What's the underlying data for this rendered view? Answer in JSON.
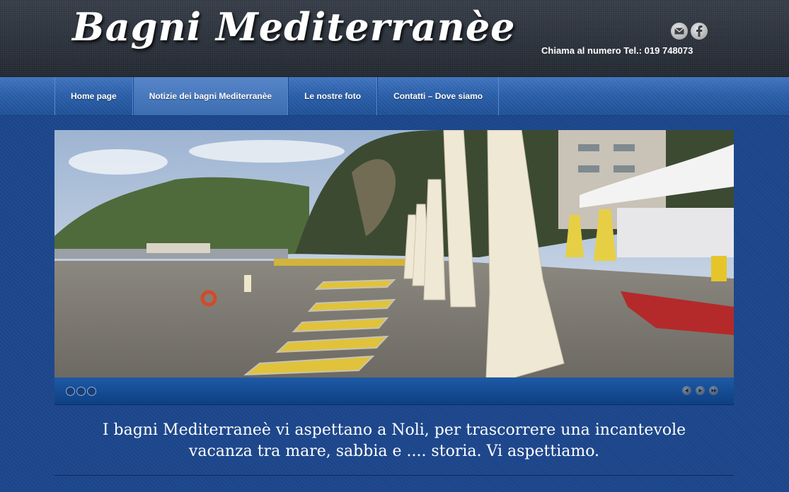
{
  "header": {
    "logo_text": "Bagni Mediterranèe",
    "phone_text": "Chiama al numero Tel.: 019 748073",
    "social": [
      {
        "icon": "mail-icon"
      },
      {
        "icon": "facebook-icon"
      }
    ]
  },
  "nav": {
    "items": [
      {
        "label": "Home page"
      },
      {
        "label": "Notizie dei bagni Mediterranèe",
        "active": true
      },
      {
        "label": "Le nostre foto"
      },
      {
        "label": "Contatti – Dove siamo"
      }
    ]
  },
  "slider": {
    "image": "beach-photo",
    "dots_count": 3,
    "controls": [
      "prev-icon",
      "play-icon",
      "next-icon"
    ]
  },
  "tagline": {
    "line1": "I bagni Mediterraneè vi aspettano a Noli, per trascorrere una incantevole",
    "line2": "vacanza tra mare, sabbia e .... storia. Vi aspettiamo."
  },
  "colors": {
    "background": "#1c468c",
    "header": "#2f3641",
    "nav": "#2a5ea8"
  }
}
